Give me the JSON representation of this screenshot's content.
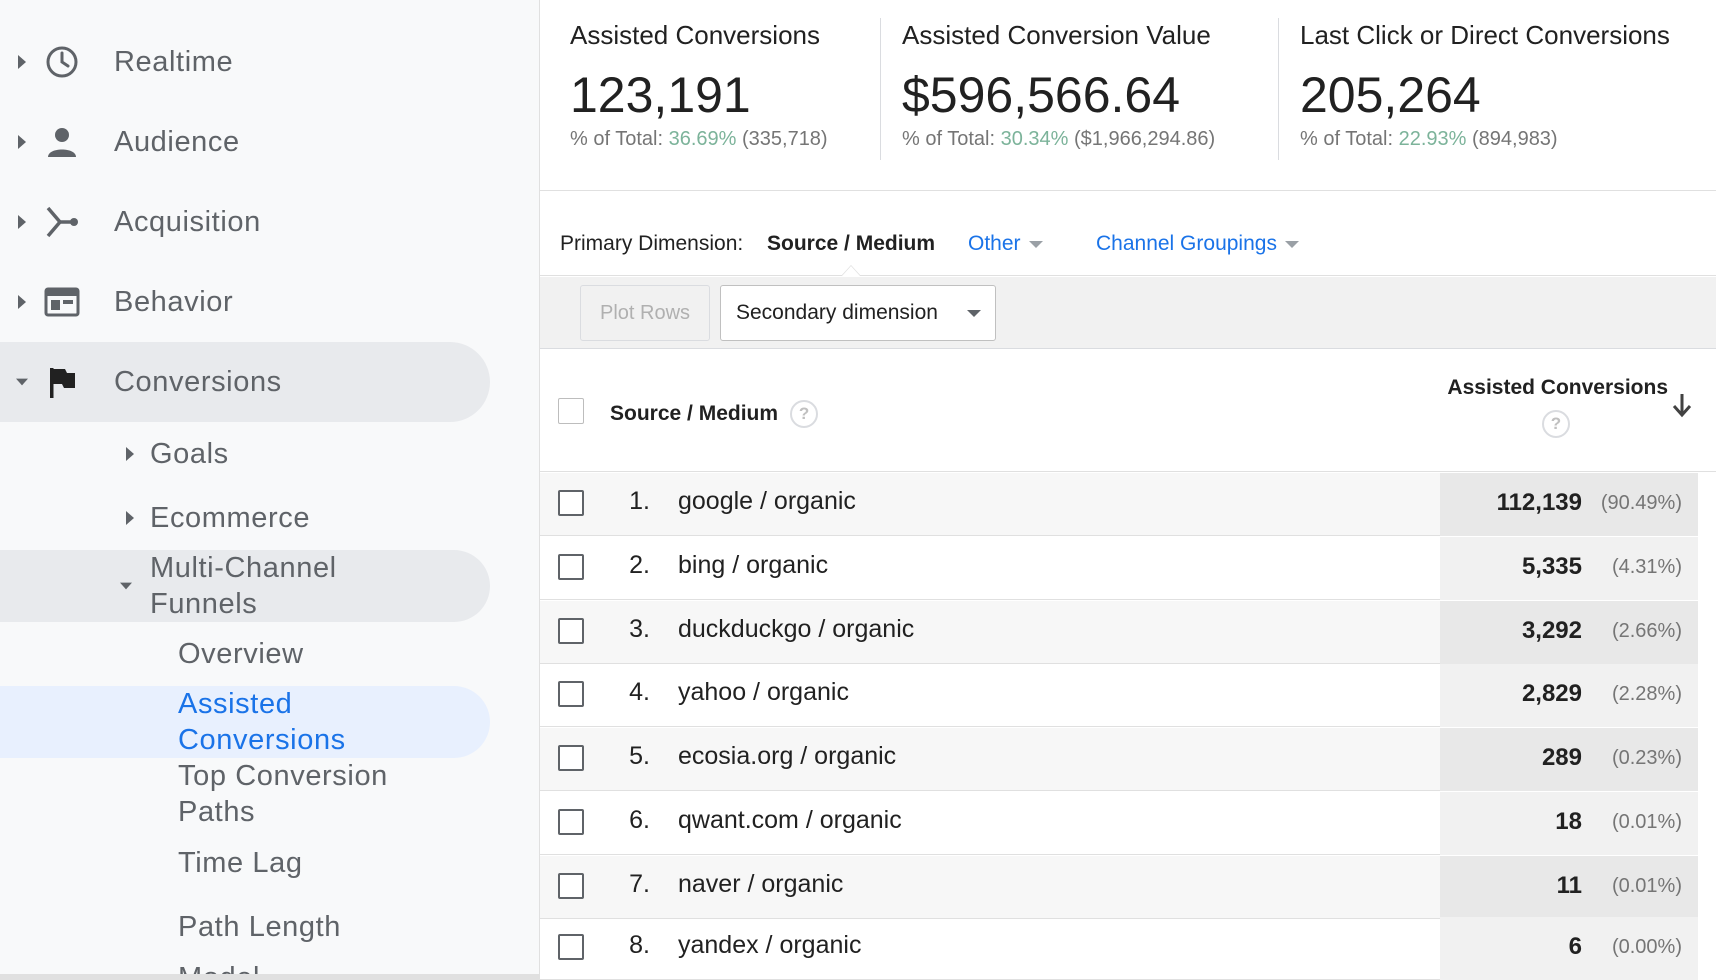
{
  "sidebar": {
    "items": [
      {
        "label": "Realtime",
        "icon": "clock-icon"
      },
      {
        "label": "Audience",
        "icon": "person-icon"
      },
      {
        "label": "Acquisition",
        "icon": "acquisition-icon"
      },
      {
        "label": "Behavior",
        "icon": "behavior-icon"
      },
      {
        "label": "Conversions",
        "icon": "flag-icon"
      }
    ],
    "conversions_children": [
      {
        "label": "Goals"
      },
      {
        "label": "Ecommerce"
      },
      {
        "label": "Multi-Channel Funnels"
      }
    ],
    "mcf_children": [
      {
        "label": "Overview"
      },
      {
        "label": "Assisted Conversions"
      },
      {
        "label": "Top Conversion Paths"
      },
      {
        "label": "Time Lag"
      },
      {
        "label": "Path Length"
      },
      {
        "label": "Model"
      }
    ]
  },
  "metrics": [
    {
      "title": "Assisted Conversions",
      "value": "123,191",
      "sub_prefix": "% of Total: ",
      "sub_pct": "36.69%",
      "sub_total": " (335,718)"
    },
    {
      "title": "Assisted Conversion Value",
      "value": "$596,566.64",
      "sub_prefix": "% of Total: ",
      "sub_pct": "30.34%",
      "sub_total": " ($1,966,294.86)"
    },
    {
      "title": "Last Click or Direct Conversions",
      "value": "205,264",
      "sub_prefix": "% of Total: ",
      "sub_pct": "22.93%",
      "sub_total": " (894,983)"
    }
  ],
  "dimension": {
    "label": "Primary Dimension:",
    "active": "Source / Medium",
    "other": "Other",
    "channel_groupings": "Channel Groupings"
  },
  "toolbar": {
    "plot_rows": "Plot Rows",
    "secondary_dimension": "Secondary dimension"
  },
  "table": {
    "col_source": "Source / Medium",
    "col_assisted": "Assisted Conversions",
    "help_glyph": "?",
    "rows": [
      {
        "idx": "1.",
        "source": "google / organic",
        "value": "112,139",
        "pct": "(90.49%)"
      },
      {
        "idx": "2.",
        "source": "bing / organic",
        "value": "5,335",
        "pct": "(4.31%)"
      },
      {
        "idx": "3.",
        "source": "duckduckgo / organic",
        "value": "3,292",
        "pct": "(2.66%)"
      },
      {
        "idx": "4.",
        "source": "yahoo / organic",
        "value": "2,829",
        "pct": "(2.28%)"
      },
      {
        "idx": "5.",
        "source": "ecosia.org / organic",
        "value": "289",
        "pct": "(0.23%)"
      },
      {
        "idx": "6.",
        "source": "qwant.com / organic",
        "value": "18",
        "pct": "(0.01%)"
      },
      {
        "idx": "7.",
        "source": "naver / organic",
        "value": "11",
        "pct": "(0.01%)"
      },
      {
        "idx": "8.",
        "source": "yandex / organic",
        "value": "6",
        "pct": "(0.00%)"
      }
    ]
  },
  "colors": {
    "accent_blue": "#1a73e8",
    "pct_green": "#7cb39a",
    "sidebar_bg": "#f8f9fa",
    "selected_bg": "#e8f0fe"
  }
}
